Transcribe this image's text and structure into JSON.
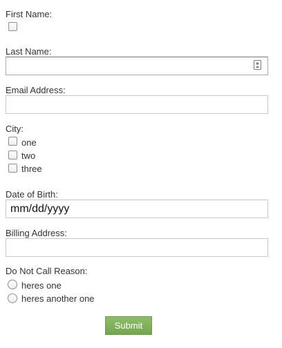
{
  "form": {
    "first_name": {
      "label": "First Name:",
      "checked": false
    },
    "last_name": {
      "label": "Last Name:",
      "value": "",
      "autofill_icon": "contact-card-icon"
    },
    "email": {
      "label": "Email Address:",
      "value": ""
    },
    "city": {
      "label": "City:",
      "options": [
        {
          "label": "one",
          "checked": false
        },
        {
          "label": "two",
          "checked": false
        },
        {
          "label": "three",
          "checked": false
        }
      ]
    },
    "date_of_birth": {
      "label": "Date of Birth:",
      "placeholder": "mm/dd/yyyy"
    },
    "billing_address": {
      "label": "Billing Address:",
      "value": ""
    },
    "do_not_call": {
      "label": "Do Not Call Reason:",
      "options": [
        {
          "label": "heres one",
          "selected": false
        },
        {
          "label": "heres another one",
          "selected": false
        }
      ]
    },
    "submit_label": "Submit"
  },
  "colors": {
    "submit_background": "#80b05d",
    "field_border": "#c9c9c9",
    "text": "#333333"
  }
}
